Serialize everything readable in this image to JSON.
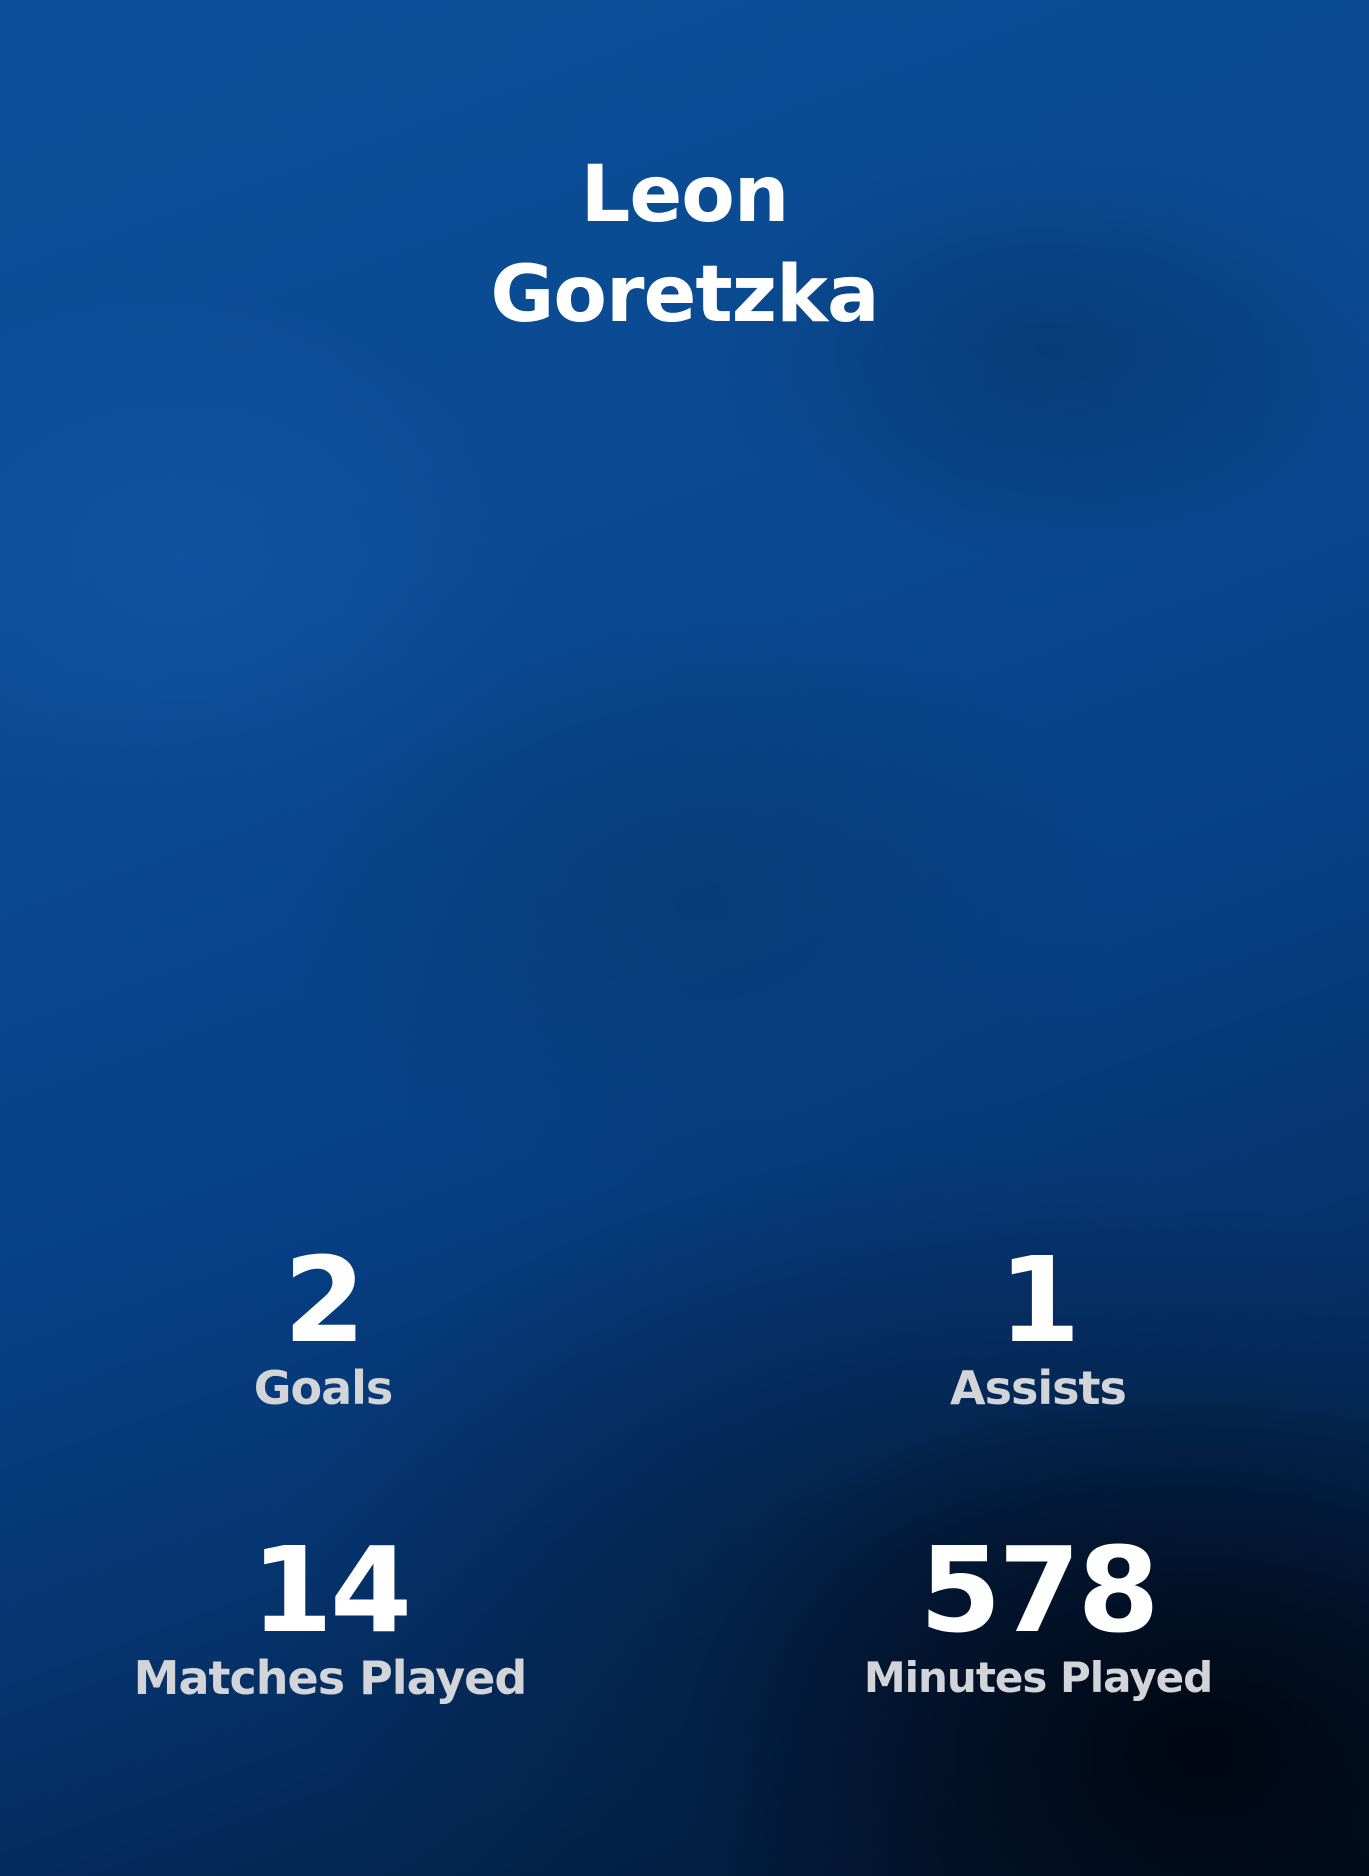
{
  "player": {
    "first_name": "Leon",
    "last_name": "Goretzka"
  },
  "stats": {
    "goals": {
      "value": "2",
      "label": "Goals"
    },
    "assists": {
      "value": "1",
      "label": "Assists"
    },
    "matches": {
      "value": "14",
      "label": "Matches Played"
    },
    "minutes": {
      "value": "578",
      "label": "Minutes Played"
    }
  },
  "colors": {
    "background": "#0a4a92",
    "value_text": "#ffffff",
    "label_text": "#d2d4d8"
  }
}
